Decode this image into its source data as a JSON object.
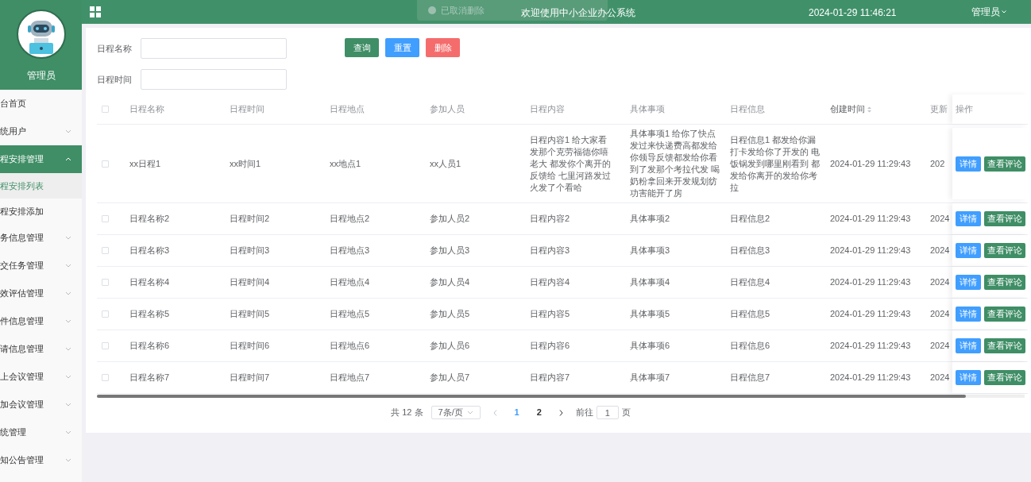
{
  "sidebar": {
    "user_name": "管理员",
    "menu": [
      {
        "label": "台首页",
        "kind": "link",
        "selected": false
      },
      {
        "label": "统用户",
        "kind": "group",
        "expanded": false
      },
      {
        "label": "程安排管理",
        "kind": "group",
        "expanded": true
      },
      {
        "label": "程安排列表",
        "kind": "sub",
        "selected": true
      },
      {
        "label": "程安排添加",
        "kind": "sub",
        "selected": false
      },
      {
        "label": "务信息管理",
        "kind": "group",
        "expanded": false
      },
      {
        "label": "交任务管理",
        "kind": "group",
        "expanded": false
      },
      {
        "label": "效评估管理",
        "kind": "group",
        "expanded": false
      },
      {
        "label": "件信息管理",
        "kind": "group",
        "expanded": false
      },
      {
        "label": "请信息管理",
        "kind": "group",
        "expanded": false
      },
      {
        "label": "上会议管理",
        "kind": "group",
        "expanded": false
      },
      {
        "label": "加会议管理",
        "kind": "group",
        "expanded": false
      },
      {
        "label": "统管理",
        "kind": "group",
        "expanded": false
      },
      {
        "label": "知公告管理",
        "kind": "group",
        "expanded": false
      }
    ]
  },
  "header": {
    "toast": "已取消删除",
    "title": "欢迎使用中小企业办公系统",
    "datetime": "2024-01-29 11:46:21",
    "user": "管理员"
  },
  "search": {
    "fields": [
      {
        "label": "日程名称"
      },
      {
        "label": "日程时间"
      }
    ],
    "buttons": [
      {
        "label": "查询",
        "kind": "primary"
      },
      {
        "label": "重置",
        "kind": "info"
      },
      {
        "label": "删除",
        "kind": "danger"
      }
    ]
  },
  "table": {
    "all_checked": false,
    "columns": [
      {
        "label": "日程名称",
        "sortable": false
      },
      {
        "label": "日程时间",
        "sortable": false
      },
      {
        "label": "日程地点",
        "sortable": false
      },
      {
        "label": "参加人员",
        "sortable": false
      },
      {
        "label": "日程内容",
        "sortable": false
      },
      {
        "label": "具体事项",
        "sortable": false
      },
      {
        "label": "日程信息",
        "sortable": false
      },
      {
        "label": "创建时间",
        "sortable": true
      },
      {
        "label": "更新",
        "sortable": false
      },
      {
        "label": "操作",
        "sortable": false
      }
    ],
    "rows": [
      {
        "checked": false,
        "cells": [
          "xx日程1",
          "xx时间1",
          "xx地点1",
          "xx人员1",
          "日程内容1 给大家看发那个克劳福德你嘻老大 都发你个离开的反馈给 七里河路发过火发了个看哈",
          "具体事项1 给你了快点发过来快递费高都发给你领导反馈都发给你看到了发那个考拉代发 喝奶粉拿回来开发规划纺功害能开了房",
          "日程信息1 都发给你漏打卡发给你了开发的 电饭锅发到哪里刚看到 都发给你离开的发给你考拉",
          "2024-01-29 11:29:43",
          "202"
        ],
        "actions": [
          "详情",
          "查看评论"
        ]
      },
      {
        "checked": false,
        "cells": [
          "日程名称2",
          "日程时间2",
          "日程地点2",
          "参加人员2",
          "日程内容2",
          "具体事项2",
          "日程信息2",
          "2024-01-29 11:29:43",
          "2024"
        ],
        "actions": [
          "详情",
          "查看评论"
        ]
      },
      {
        "checked": false,
        "cells": [
          "日程名称3",
          "日程时间3",
          "日程地点3",
          "参加人员3",
          "日程内容3",
          "具体事项3",
          "日程信息3",
          "2024-01-29 11:29:43",
          "2024"
        ],
        "actions": [
          "详情",
          "查看评论"
        ]
      },
      {
        "checked": false,
        "cells": [
          "日程名称4",
          "日程时间4",
          "日程地点4",
          "参加人员4",
          "日程内容4",
          "具体事项4",
          "日程信息4",
          "2024-01-29 11:29:43",
          "2024"
        ],
        "actions": [
          "详情",
          "查看评论"
        ]
      },
      {
        "checked": false,
        "cells": [
          "日程名称5",
          "日程时间5",
          "日程地点5",
          "参加人员5",
          "日程内容5",
          "具体事项5",
          "日程信息5",
          "2024-01-29 11:29:43",
          "2024"
        ],
        "actions": [
          "详情",
          "查看评论"
        ]
      },
      {
        "checked": false,
        "cells": [
          "日程名称6",
          "日程时间6",
          "日程地点6",
          "参加人员6",
          "日程内容6",
          "具体事项6",
          "日程信息6",
          "2024-01-29 11:29:43",
          "2024"
        ],
        "actions": [
          "详情",
          "查看评论"
        ]
      },
      {
        "checked": false,
        "cells": [
          "日程名称7",
          "日程时间7",
          "日程地点7",
          "参加人员7",
          "日程内容7",
          "具体事项7",
          "日程信息7",
          "2024-01-29 11:29:43",
          "2024"
        ],
        "actions": [
          "详情",
          "查看评论"
        ]
      }
    ]
  },
  "pagination": {
    "total": "共 12 条",
    "page_size": "7条/页",
    "prev_disabled": true,
    "next_disabled": false,
    "pages": [
      {
        "label": "1",
        "selected": true
      },
      {
        "label": "2",
        "selected": false
      }
    ],
    "goto_label": "前往",
    "goto_value": "1",
    "goto_suffix": "页"
  }
}
